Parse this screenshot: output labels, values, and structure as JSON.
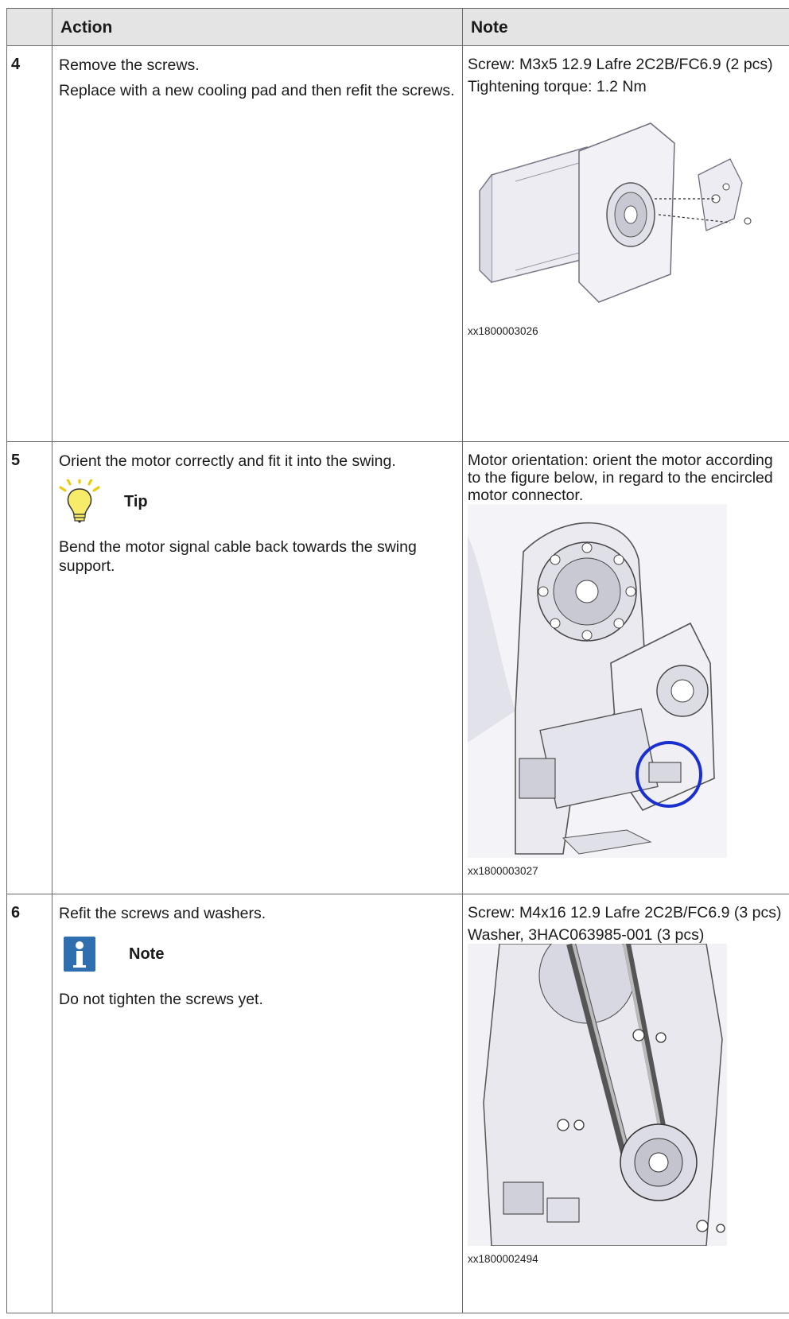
{
  "header": {
    "col1": "",
    "col2": "Action",
    "col3": "Note"
  },
  "rows": [
    {
      "num": "4",
      "action": [
        "Remove the screws.",
        "Replace with a new cooling pad and then refit the screws."
      ],
      "notes": [
        "Screw: M3x5 12.9 Lafre 2C2B/FC6.9 (2 pcs)",
        "Tightening torque: 1.2 Nm"
      ],
      "figure_id": "xx1800003026"
    },
    {
      "num": "5",
      "action": [
        "Orient the motor correctly and fit it into the swing."
      ],
      "admonition": {
        "type": "tip",
        "label": "Tip",
        "text": "Bend the motor signal cable back towards the swing support."
      },
      "notes": [
        "Motor orientation: orient the motor according to the figure below, in regard to the encircled motor connector."
      ],
      "figure_id": "xx1800003027"
    },
    {
      "num": "6",
      "action": [
        "Refit the screws and washers."
      ],
      "admonition": {
        "type": "note",
        "label": "Note",
        "text": "Do not tighten the screws yet."
      },
      "notes": [
        "Screw: M4x16 12.9 Lafre 2C2B/FC6.9 (3 pcs)",
        "Washer, 3HAC063985-001 (3 pcs)"
      ],
      "figure_id": "xx1800002494"
    }
  ],
  "colors": {
    "header_bg": "#e4e4e4",
    "border": "#6a6a6a",
    "note_icon": "#2f6fb0",
    "tip_bulb": "#f4e04a",
    "encircle": "#1a2fd0"
  }
}
